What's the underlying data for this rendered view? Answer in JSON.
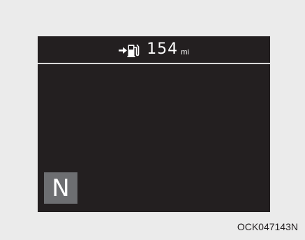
{
  "cluster": {
    "range": {
      "icon": "arrow-fuel-pump-icon",
      "value": "154",
      "unit": "mi"
    },
    "gear": "N"
  },
  "caption": "OCK047143N",
  "colors": {
    "background": "#ebebeb",
    "display": "#231f20",
    "gear_box": "#6d6e71",
    "text": "#ffffff"
  }
}
